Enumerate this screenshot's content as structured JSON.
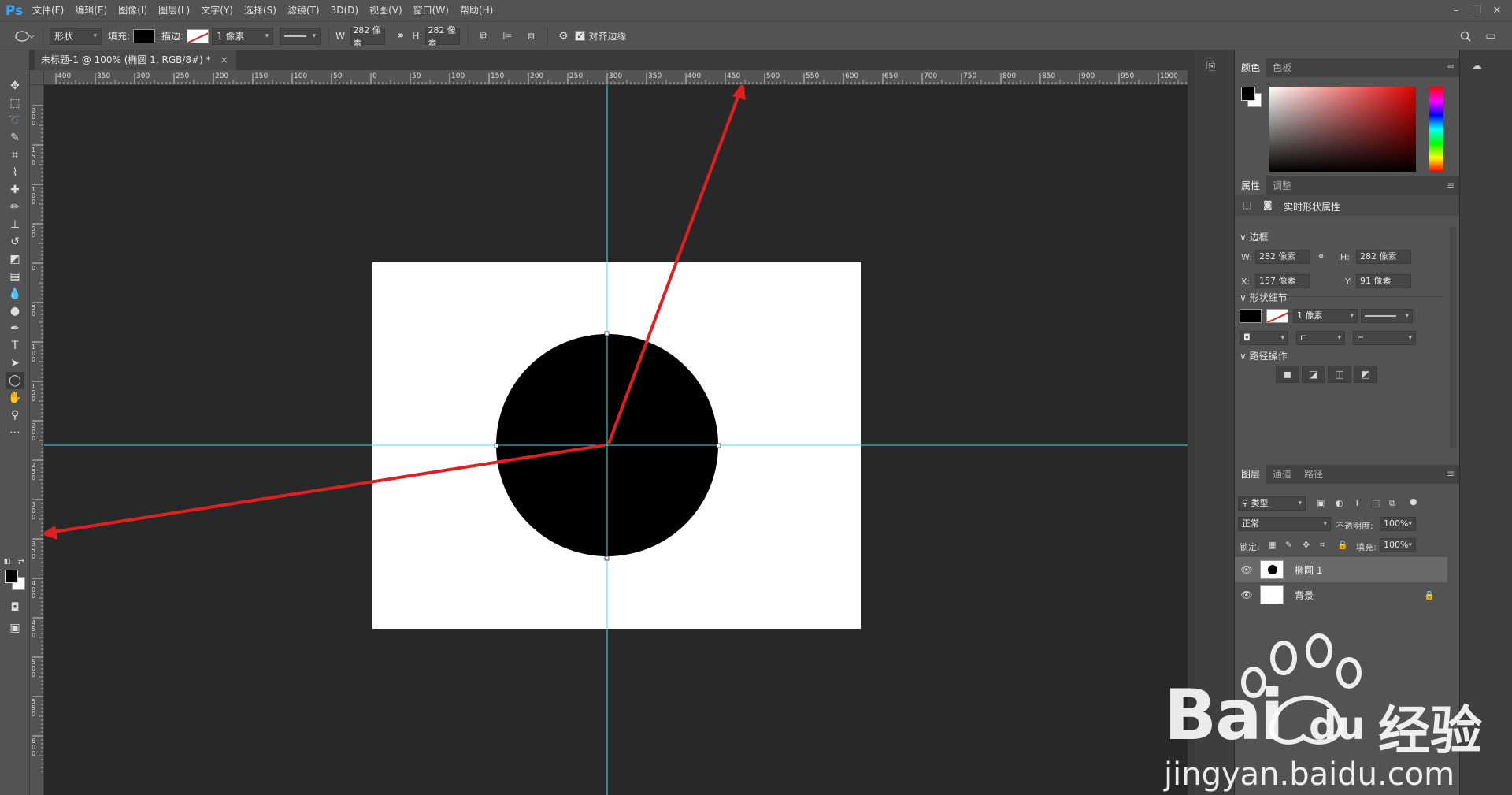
{
  "app": {
    "logo": "Ps"
  },
  "menu": [
    "文件(F)",
    "编辑(E)",
    "图像(I)",
    "图层(L)",
    "文字(Y)",
    "选择(S)",
    "滤镜(T)",
    "3D(D)",
    "视图(V)",
    "窗口(W)",
    "帮助(H)"
  ],
  "window_controls": {
    "minimize": "–",
    "restore": "❐",
    "close": "✕"
  },
  "options": {
    "mode": "形状",
    "fill_label": "填充:",
    "stroke_label": "描边:",
    "stroke_width": "1 像素",
    "w_label": "W:",
    "w_value": "282 像素",
    "h_label": "H:",
    "h_value": "282 像素",
    "align_edges": "对齐边缘"
  },
  "document": {
    "tab_title": "未标题-1 @ 100% (椭圆 1, RGB/8#) *",
    "close": "×"
  },
  "ruler": {
    "h_labels": [
      "400",
      "350",
      "300",
      "250",
      "200",
      "150",
      "100",
      "50",
      "0",
      "50",
      "100",
      "150",
      "200",
      "250",
      "300",
      "350",
      "400",
      "450",
      "500",
      "550",
      "600",
      "650",
      "700",
      "750",
      "800",
      "850",
      "900",
      "950",
      "1000"
    ],
    "v_labels": [
      "2 0 0",
      "1 5 0",
      "1 0 0",
      "5 0",
      "0",
      "5 0",
      "1 0 0",
      "1 5 0",
      "2 0 0",
      "2 5 0",
      "3 0 0",
      "3 5 0",
      "4 0 0",
      "4 5 0",
      "5 0 0",
      "5 5 0",
      "6 0 0"
    ]
  },
  "color_panel": {
    "tabs": [
      "颜色",
      "色板"
    ]
  },
  "properties_panel": {
    "tabs": [
      "属性",
      "调整"
    ],
    "header": "实时形状属性",
    "bounds_title": "边框",
    "w_label": "W:",
    "w_value": "282 像素",
    "h_label": "H:",
    "h_value": "282 像素",
    "x_label": "X:",
    "x_value": "157 像素",
    "y_label": "Y:",
    "y_value": "91 像素",
    "shape_title": "形状细节",
    "stroke_width": "1 像素",
    "path_ops_title": "路径操作"
  },
  "layers_panel": {
    "tabs": [
      "图层",
      "通道",
      "路径"
    ],
    "filter": "类型",
    "blend_mode": "正常",
    "opacity_label": "不透明度:",
    "opacity_value": "100%",
    "lock_label": "锁定:",
    "fill_label": "填充:",
    "fill_value": "100%",
    "layers": [
      {
        "name": "椭圆 1",
        "selected": true
      },
      {
        "name": "背景",
        "selected": false,
        "locked": true
      }
    ]
  },
  "watermark": {
    "brand": "Bai",
    "brand2": "du",
    "brand_cn": "经验",
    "url": "jingyan.baidu.com"
  },
  "colors": {
    "accent": "#31a8ff",
    "guide": "#41e0f0",
    "arrow": "#e02020"
  }
}
